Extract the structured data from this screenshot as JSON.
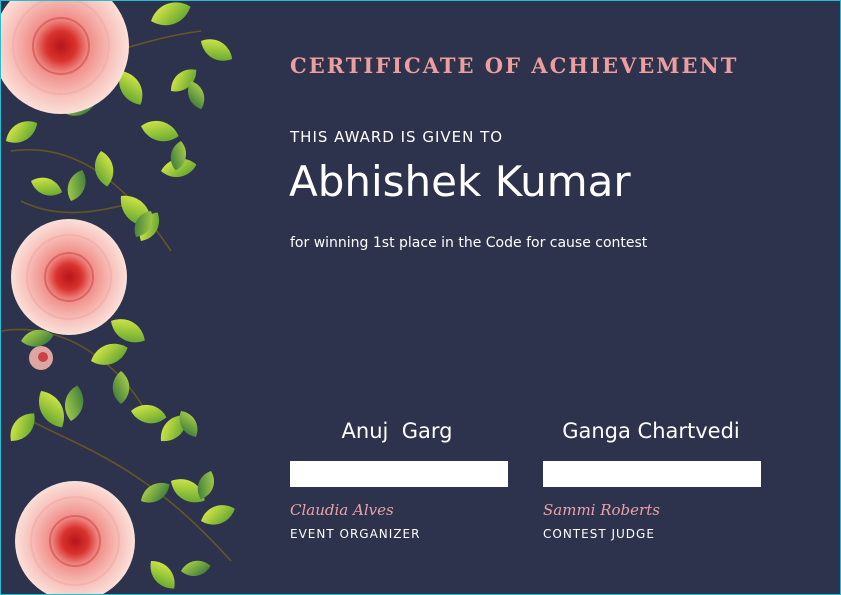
{
  "certificate": {
    "title": "CERTIFICATE OF ACHIEVEMENT",
    "given_to": "THIS AWARD IS GIVEN TO",
    "recipient": "Abhishek Kumar",
    "reason": "for winning 1st place in the Code for cause contest"
  },
  "signatures": [
    {
      "signed_name": "Anuj  Garg",
      "signer": "Claudia Alves",
      "role": "EVENT ORGANIZER"
    },
    {
      "signed_name": "Ganga Chartvedi",
      "signer": "Sammi Roberts",
      "role": "CONTEST JUDGE"
    }
  ],
  "colors": {
    "background": "#2d324d",
    "title": "#ee9e9c",
    "signer": "#e9a3a6",
    "border": "#27bcd0"
  }
}
